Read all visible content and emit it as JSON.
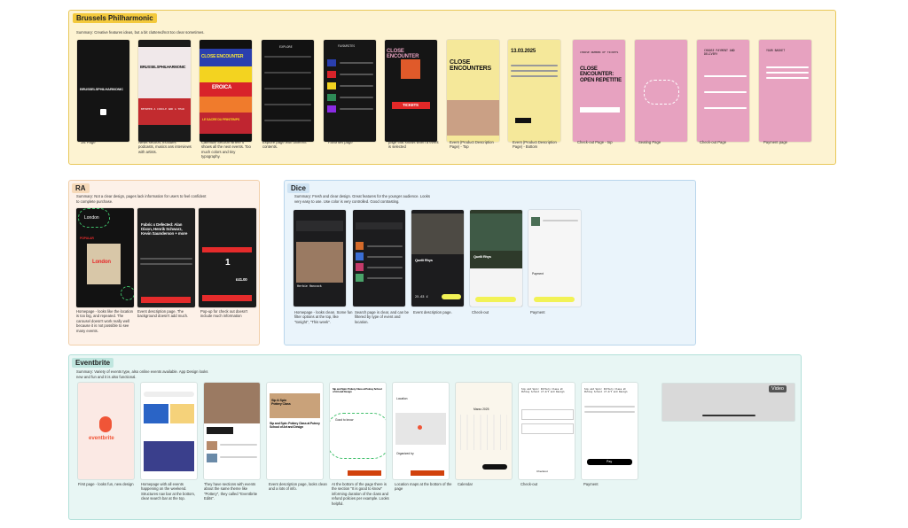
{
  "brussels": {
    "title": "Brussels Philharmonic",
    "summary": "Summary: Creative features ideas, but a bit cluttered/not too clear sometimes.",
    "captions": [
      "1st Page",
      "News section, includes podcasts, musics ans interviews with artists.",
      "Calendar Section where it shows all the next events. Too much colors and tiny typography.",
      "Explore page with different contents.",
      "Favorites page",
      "page that shows when a event is selected",
      "Event (Product Description Page) - Top",
      "Event (Product Description Page) - Bottom",
      "Check-out Page - top",
      "Seating Page",
      "Check-out Page",
      "Payment page"
    ],
    "screen_text": {
      "logo": "BRUSSELSPHILHARMONIC",
      "close_encounter": "CLOSE ENCOUNTER",
      "close_encounters": "CLOSE ENCOUNTERS",
      "eroica": "EROICA",
      "sacre": "LE SACRE DU PRINTEMPS",
      "date": "13.03.2025",
      "explore": "EXPLORE",
      "tickets": "TICKETS",
      "choose_tickets": "CHOOSE NUMBER OF TICKETS",
      "open_rep": "CLOSE ENCOUNTER: OPEN REPETITIE",
      "choose_payment": "CHOOSE PAYMENT AND DELIVERY",
      "your_basket": "YOUR BASKET",
      "favourites": "FAVOURITES",
      "between": "BETWEEN A CIRCLE AND A TEAR"
    }
  },
  "ra": {
    "title": "RA",
    "summary": "Summary: Not a clear design, pages lack information for users to feel confident to complete purchase.",
    "captions": [
      "Homepage - looks like the location is too big, and repeated. The carousel doesn't work really well because it is not possible to see many events.",
      "Event description page. The background doesn't add much.",
      "Pop-up for check out doesn't include much information"
    ],
    "screen_text": {
      "london": "London",
      "popular": "POPULAR",
      "event_title": "Fabric x Defected: Alan Dixon, Henrik Schwarz, Kevin Saunderson + more",
      "price": "£41.00",
      "qty": "1"
    }
  },
  "dice": {
    "title": "Dice",
    "summary": "Summary: Fresh and clear design. Great features for the younger audience. Looks very easy to use. Use color is very controlled. Good contrasting.",
    "captions": [
      "Homepage - looks clean. Some fun filter options at the top, like \"tonight\", \"This week\".",
      "Search page is clear, and can be filtered by type of event and location.",
      "Event description page.",
      "Check-out",
      "Payment"
    ],
    "screen_text": {
      "artist": "Quelli Rhys",
      "herbie": "Herbie Hancock",
      "price": "25.63 £",
      "payment": "Payment"
    }
  },
  "eventbrite": {
    "title": "Eventbrite",
    "summary": "Summary: Variety of events type, also online events available. App Design looks new and fun and it is also functional.",
    "captions": [
      "First page - looks fun, new design",
      "Homepage with all events happening on the weekend. Structures nav bar at the bottom, clear search bar at the top.",
      "They have sections with events about the same theme like \"Pottery\", they called \"Eventbrite Edits\".",
      "Event description page, looks clean and a lots of info.",
      "At the bottom of the page there is the section \"It is good to know\" informing duration of the class and refund policies per example. Looks helpful.",
      "Location maps at the bottom of the page",
      "Calendar",
      "Check-out",
      "Payment"
    ],
    "screen_text": {
      "logo": "eventbrite",
      "sip_spin": "Sip and Spin: Pottery Class at Putney School of Art and Design",
      "sip_spin_short": "Sip & Spin Pottery Class",
      "good_to_know": "Good to know",
      "location": "Location",
      "organized_by": "Organized by",
      "calendar_month": "Marzo 2025",
      "checkout": "Checkout",
      "pay": "Pay",
      "get_tickets": "Get Tickets"
    },
    "video_label": "Video"
  },
  "colors": {
    "yellow_bg": "#fdf3d2",
    "yellow_border": "#e9c85a",
    "yellow_label": "#f3c93c",
    "peach_bg": "#fdf1e8",
    "peach_border": "#f1cfa9",
    "peach_label": "#f6d9b8",
    "blue_bg": "#eaf4fb",
    "blue_border": "#b9d6ec",
    "blue_label": "#cfe3f3",
    "teal_bg": "#e8f6f4",
    "teal_border": "#b2e0d9",
    "teal_label": "#bfe6df",
    "bp_pink": "#e7a2c0",
    "bp_yellow": "#f5e89a",
    "bp_red": "#e02a2a",
    "dice_yellow": "#f2f255",
    "ra_red": "#e52b2b",
    "eventbrite_orange": "#f05537"
  }
}
